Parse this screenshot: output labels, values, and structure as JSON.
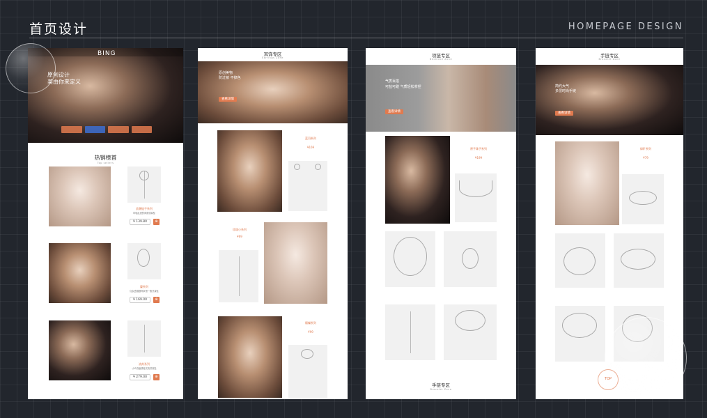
{
  "header": {
    "title": "首页设计",
    "subtitle": "HOMEPAGE DESIGN"
  },
  "panel1": {
    "logo": "BING",
    "hero_line1": "原创设计",
    "hero_line2": "美由你来定义",
    "section_title": "热销榜首",
    "section_sub": "Top sellers",
    "products": [
      {
        "name": "浪潮链子系列",
        "desc": "年轻乱透的风质感耳坠",
        "price": "¥ 139.80"
      },
      {
        "name": "蔓系列",
        "desc": "仙女盘缠银饰永恒一般式耳坠",
        "price": "¥ 169.00"
      },
      {
        "name": "流苏系列",
        "desc": "小众高级感轻灵流苏耳坠",
        "price": "¥ 279.00"
      }
    ]
  },
  "panel2": {
    "title": "耳饰专区",
    "sub": "Earrings Zone",
    "hero_line1": "原创美物",
    "hero_line2": "防过敏 不掉色",
    "button": "查看详情",
    "products": [
      {
        "name": "蓝羽系列",
        "price": "¥169"
      },
      {
        "name": "珍珠小系列",
        "price": "¥69"
      },
      {
        "name": "缎蝶系列",
        "price": "¥99"
      }
    ]
  },
  "panel3": {
    "title": "项链专区",
    "sub": "Necklace Zone",
    "hero_line1": "气质百搭",
    "hero_line2": "可盐可甜 气质轻松拿捏",
    "button": "查看详情",
    "products": [
      {
        "name": "原子珠子系列",
        "price": "¥199"
      }
    ],
    "bottom_title": "手链专区",
    "bottom_sub": "Bracelet Zone"
  },
  "panel4": {
    "title": "手链专区",
    "sub": "Bracelet Zone",
    "hero_line1": "简约大气",
    "hero_line2": "多层时尚手链",
    "button": "查看详情",
    "products": [
      {
        "name": "绿矿系列",
        "price": "¥79"
      }
    ],
    "badge": "TOP"
  }
}
